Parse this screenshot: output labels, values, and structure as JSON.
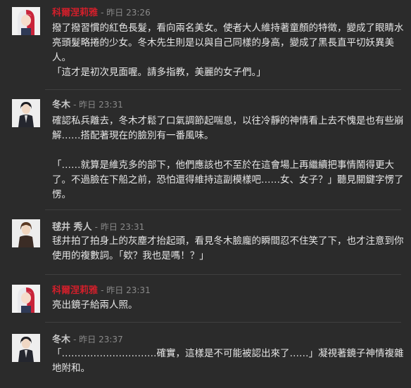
{
  "messages": [
    {
      "author": "科爾涅莉雅",
      "timestamp": "- 昨日 23:26",
      "author_color": "#d21f2b",
      "avatar_icon": "white-red-hair-girl-avatar",
      "paragraphs": [
        "撥了撥習慣的紅色長髮，看向兩名美女。使者大人維持著童顏的特徵，變成了眼睛水亮頭髮略捲的少女。冬木先生則是以與自己同樣的身高，變成了黑長直平切妖異美人。\n「這才是初次見面喔。請多指教，美麗的女子們。」"
      ]
    },
    {
      "author": "冬木",
      "timestamp": "- 昨日 23:31",
      "author_color": "#c8c8c8",
      "avatar_icon": "dark-suit-man-avatar",
      "paragraphs": [
        "確認私兵離去，冬木才鬆了口氣調節起喘息，以往冷靜的神情看上去不愧是也有些崩解……搭配著現在的臉別有一番風味。",
        "「……就算是維克多的部下，他們應該也不至於在這會場上再繼續把事情鬧得更大了。不過臉在下船之前，恐怕還得維持這副模樣吧……女、女子？」聽見關鍵字愣了愣。"
      ]
    },
    {
      "author": "毬井 秀人",
      "timestamp": "- 昨日 23:31",
      "author_color": "#c8c8c8",
      "avatar_icon": "brown-hair-boy-avatar",
      "paragraphs": [
        "毬井拍了拍身上的灰塵才抬起頭，看見冬木臉龐的瞬間忍不住笑了下，也才注意到你使用的複數詞。「欸？我也是嗎！？」"
      ]
    },
    {
      "author": "科爾涅莉雅",
      "timestamp": "- 昨日 23:31",
      "author_color": "#d21f2b",
      "avatar_icon": "white-red-hair-girl-avatar",
      "paragraphs": [
        "亮出鏡子給兩人照。"
      ]
    },
    {
      "author": "冬木",
      "timestamp": "- 昨日 23:37",
      "author_color": "#c8c8c8",
      "avatar_icon": "dark-suit-man-avatar",
      "paragraphs": [
        "「…………………………確實，這樣是不可能被認出來了……」凝視著鏡子神情複雜地附和。"
      ]
    }
  ]
}
